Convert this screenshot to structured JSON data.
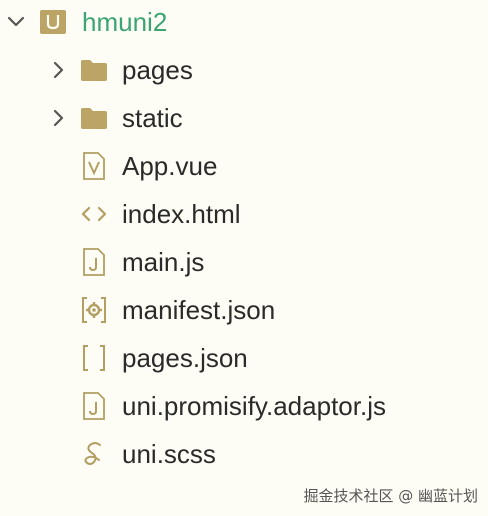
{
  "colors": {
    "background": "#fefdf5",
    "project_label": "#3aa571",
    "folder_icon": "#bca366",
    "file_icon": "#b39e63",
    "chevron": "#555555",
    "text": "#2a2a2a"
  },
  "tree": {
    "project": {
      "label": "hmuni2",
      "expanded": true,
      "icon": "project-folder-icon"
    },
    "items": [
      {
        "label": "pages",
        "type": "folder",
        "icon": "folder-icon"
      },
      {
        "label": "static",
        "type": "folder",
        "icon": "folder-icon"
      },
      {
        "label": "App.vue",
        "type": "file",
        "icon": "vue-file-icon"
      },
      {
        "label": "index.html",
        "type": "file",
        "icon": "html-file-icon"
      },
      {
        "label": "main.js",
        "type": "file",
        "icon": "js-file-icon"
      },
      {
        "label": "manifest.json",
        "type": "file",
        "icon": "settings-file-icon"
      },
      {
        "label": "pages.json",
        "type": "file",
        "icon": "json-file-icon"
      },
      {
        "label": "uni.promisify.adaptor.js",
        "type": "file",
        "icon": "js-file-icon"
      },
      {
        "label": "uni.scss",
        "type": "file",
        "icon": "sass-file-icon"
      }
    ]
  },
  "watermark": "掘金技术社区 @ 幽蓝计划"
}
